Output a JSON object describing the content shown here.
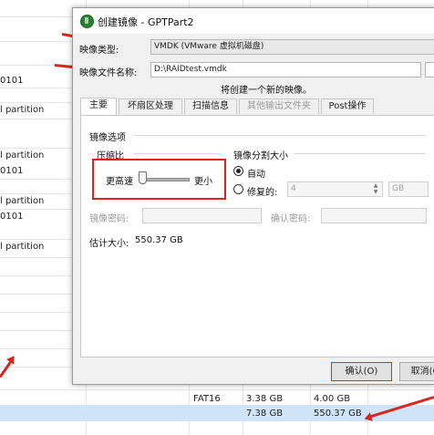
{
  "background": {
    "left_rows": [
      "0101",
      "l partition",
      "l partition",
      "0101",
      "l partition",
      "0101",
      "l partition"
    ],
    "table_rows": [
      {
        "fs": "FAT16",
        "size": "3.38 GB",
        "used": "4.00 GB"
      },
      {
        "fs": "",
        "size": "7.38 GB",
        "used": "550.37 GB"
      }
    ]
  },
  "dialog": {
    "title": "创建镜像 - GPTPart2",
    "image_type_label": "映像类型:",
    "image_type_value": "VMDK (VMware 虚拟机磁盘)",
    "file_name_label": "映像文件名称:",
    "file_name_value": "D:\\RAIDtest.vmdk",
    "info_text": "将创建一个新的映像。",
    "tabs": [
      {
        "label": "主要",
        "active": true
      },
      {
        "label": "坏扇区处理",
        "active": false
      },
      {
        "label": "扫描信息",
        "active": false
      },
      {
        "label": "其他输出文件夹",
        "active": false,
        "disabled": true
      },
      {
        "label": "Post操作",
        "active": false
      }
    ],
    "options_group": "镜像选项",
    "compression_label": "压缩比",
    "slider_min_label": "更高速",
    "slider_max_label": "更小",
    "split_label": "镜像分割大小",
    "radio_auto": "自动",
    "radio_fixed": "修复的:",
    "fixed_value": "4",
    "unit_value": "GB",
    "password_label": "镜像密码:",
    "confirm_label": "确认密码:",
    "estimate_label": "估计大小:",
    "estimate_value": "550.37 GB",
    "ok_button": "确认(O)",
    "cancel_button": "取消(C)"
  },
  "colors": {
    "annotation_red": "#d9261c",
    "selection_blue": "#cfe5f7"
  }
}
